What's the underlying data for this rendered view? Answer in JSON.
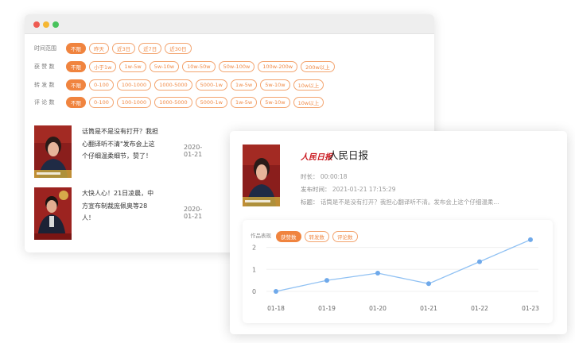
{
  "colors": {
    "accent": "#f0843f",
    "line": "#90c1f3",
    "point": "#6fa9ea",
    "brand_red": "#c9161d"
  },
  "back_window": {
    "filters": [
      {
        "label": "时间范围",
        "options": [
          "不限",
          "昨天",
          "近3日",
          "近7日",
          "近30日"
        ],
        "active": 0
      },
      {
        "label": "获 赞 数",
        "options": [
          "不限",
          "小于1w",
          "1w-5w",
          "5w-10w",
          "10w-50w",
          "50w-100w",
          "100w-200w",
          "200w以上"
        ],
        "active": 0
      },
      {
        "label": "转 发 数",
        "options": [
          "不限",
          "0-100",
          "100-1000",
          "1000-5000",
          "5000-1w",
          "1w-5w",
          "5w-10w",
          "10w以上"
        ],
        "active": 0
      },
      {
        "label": "评 论 数",
        "options": [
          "不限",
          "0-100",
          "100-1000",
          "1000-5000",
          "5000-1w",
          "1w-5w",
          "5w-10w",
          "10w以上"
        ],
        "active": 0
      }
    ],
    "news": [
      {
        "title": "话筒是不是没有打开？我担心翻译听不清\"发布会上这个仔细温柔细节，赞了！",
        "date": "2020-01-21"
      },
      {
        "title": "大快人心！21日凌晨，中方宣布制裁庞佩奥等28人！",
        "date": "2020-01-21"
      }
    ]
  },
  "detail_card": {
    "logo_text": "人民日报",
    "source_name": "人民日报",
    "duration_label": "时长：",
    "duration": "00:00:18",
    "publish_label": "发布时间：",
    "publish_time": "2021-01-21  17:15:29",
    "title_label": "标题：",
    "title": "话筒是不是没有打开？我担心翻译听不清。发布会上这个仔细温柔...",
    "chart_toolbar": {
      "label": "作品表现",
      "tabs": [
        "获赞数",
        "转发数",
        "评论数"
      ],
      "active": 0
    }
  },
  "chart_data": {
    "type": "line",
    "categories": [
      "01-18",
      "01-19",
      "01-20",
      "01-21",
      "01-22",
      "01-23"
    ],
    "values": [
      0,
      0.5,
      0.83,
      0.35,
      1.35,
      2.35
    ],
    "yticks": [
      0,
      1,
      2
    ],
    "ylim": [
      0,
      2.6
    ]
  }
}
